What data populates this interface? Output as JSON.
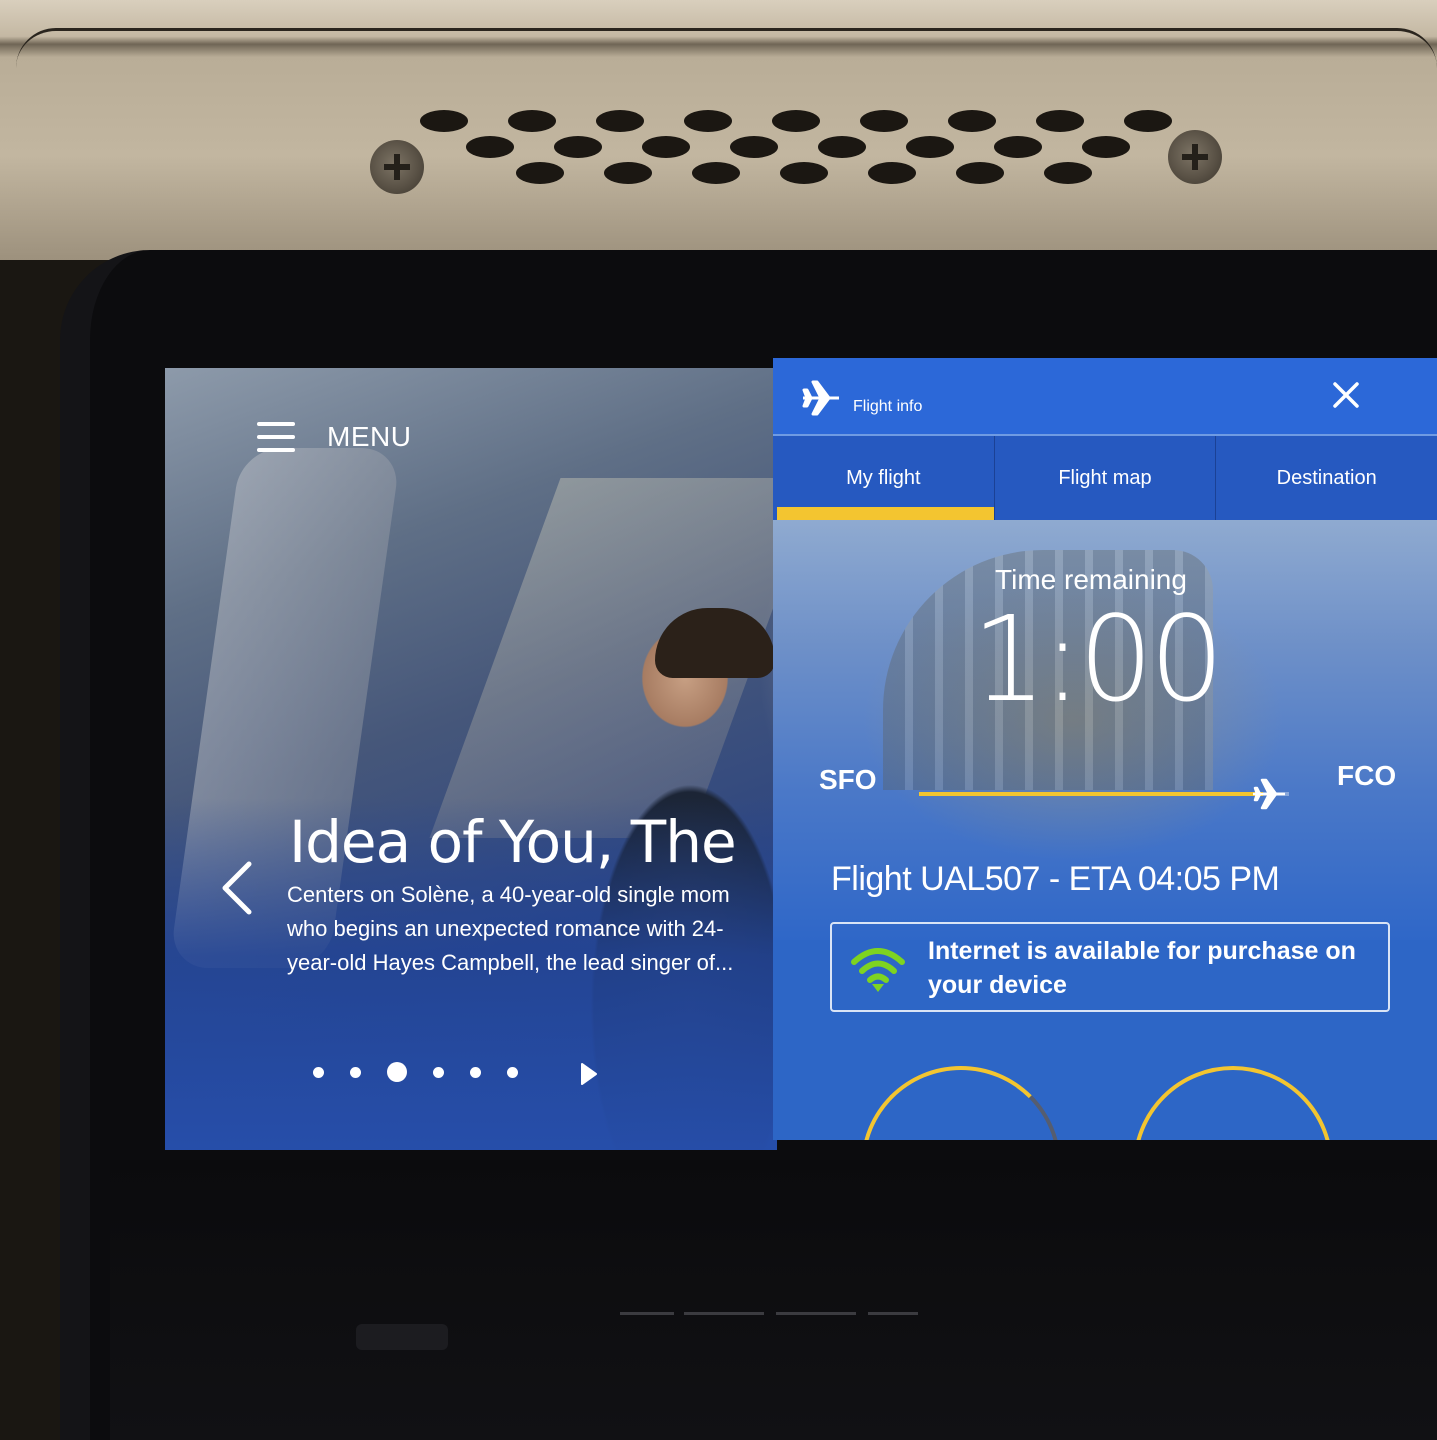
{
  "media": {
    "menu_label": "MENU",
    "title": "Idea of You, The",
    "description": "Centers on Solène, a 40-year-old single mom who begins an unexpected romance with 24-year-old Hayes Campbell, the lead singer of...",
    "carousel": {
      "count": 6,
      "active_index": 2
    },
    "icons": {
      "menu": "hamburger-icon",
      "prev": "chevron-left-icon",
      "next": "play-triangle-icon"
    }
  },
  "flight_info": {
    "header_title": "Flight info",
    "tabs": [
      {
        "label": "My flight",
        "active": true
      },
      {
        "label": "Flight map",
        "active": false
      },
      {
        "label": "Destination",
        "active": false
      }
    ],
    "time_remaining_label": "Time remaining",
    "time_remaining_value": "1:00",
    "origin": "SFO",
    "destination": "FCO",
    "progress": 0.93,
    "flight_line": "Flight UAL507 - ETA 04:05 PM",
    "wifi_message": "Internet is available for purchase on your device",
    "colors": {
      "accent": "#f3c530",
      "panel_blue": "#2d66c6",
      "wifi_green": "#7ed321"
    },
    "icons": {
      "header": "airplane-icon",
      "close": "close-icon",
      "wifi": "wifi-icon",
      "route": "airplane-icon"
    }
  }
}
